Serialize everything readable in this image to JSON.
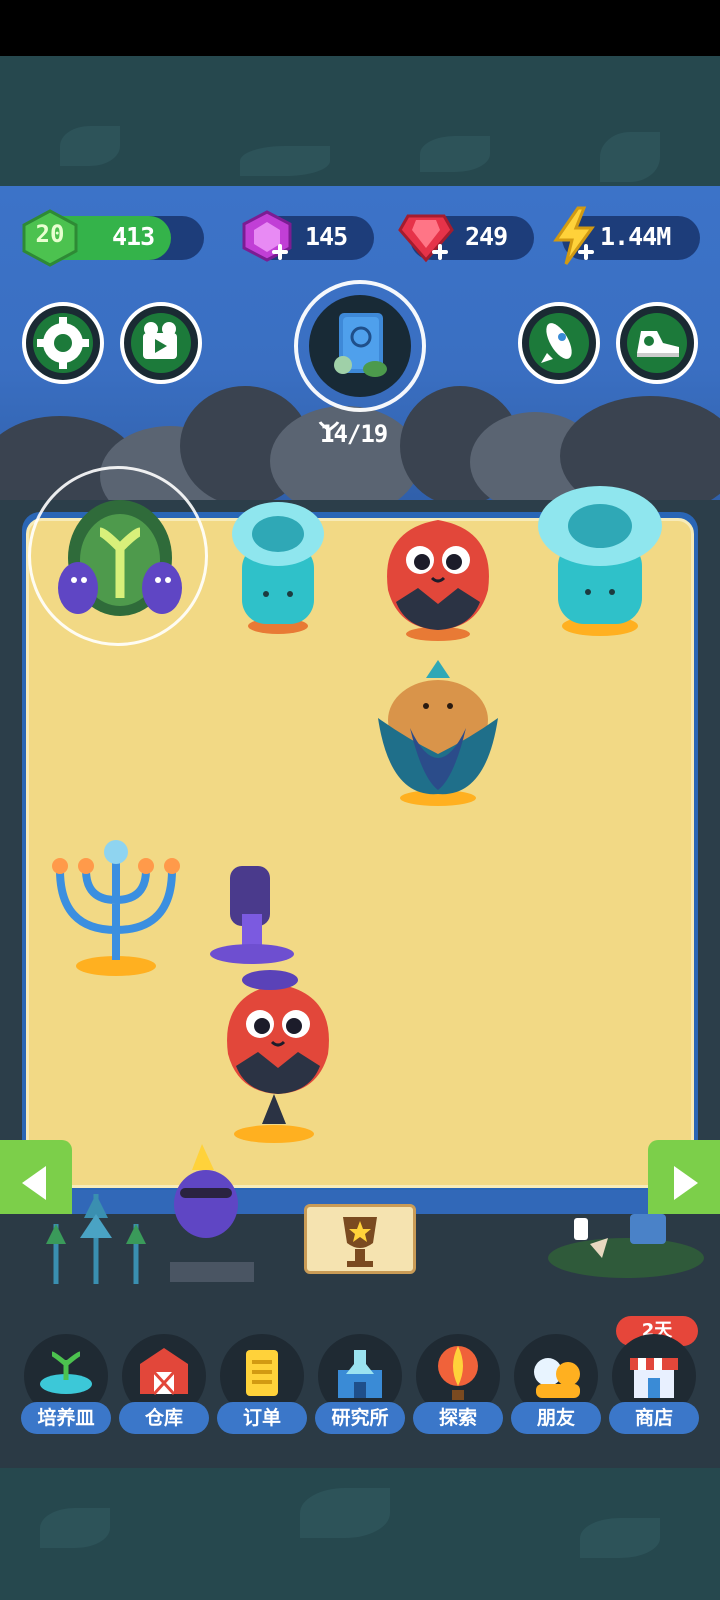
{
  "hud": {
    "level": "20",
    "xp": "413",
    "level_progress": 0.8,
    "gems_purple": "145",
    "gems_red": "249",
    "energy": "1.44M"
  },
  "collection": {
    "progress_text": "14/19"
  },
  "menu": {
    "items": [
      {
        "label": "培养皿",
        "icon": "petri-dish-icon"
      },
      {
        "label": "仓库",
        "icon": "barn-icon"
      },
      {
        "label": "订单",
        "icon": "order-scroll-icon"
      },
      {
        "label": "研究所",
        "icon": "lab-icon"
      },
      {
        "label": "探索",
        "icon": "hot-air-balloon-icon"
      },
      {
        "label": "朋友",
        "icon": "friends-icon"
      },
      {
        "label": "商店",
        "icon": "shop-icon"
      }
    ],
    "shop_badge": "2天"
  },
  "colors": {
    "accent_green": "#34b34a",
    "menu_label_blue": "#3b77c9",
    "badge_red": "#e6463a",
    "board_sand": "#f2d985"
  }
}
